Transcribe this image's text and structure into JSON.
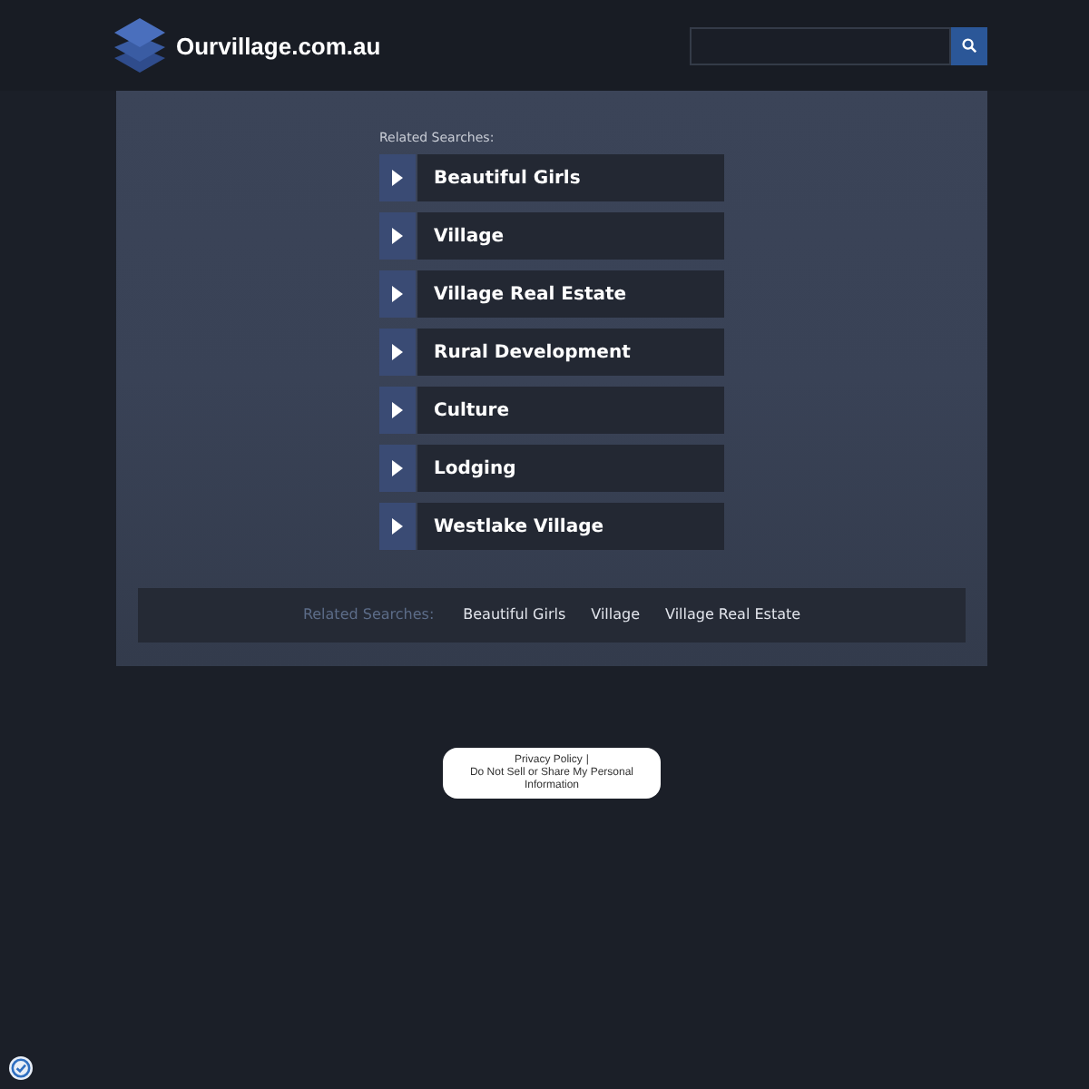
{
  "header": {
    "site_name": "Ourvillage.com.au"
  },
  "related_searches": {
    "heading": "Related Searches:",
    "items": [
      "Beautiful Girls",
      "Village",
      "Village Real Estate",
      "Rural Development",
      "Culture",
      "Lodging",
      "Westlake Village"
    ]
  },
  "footer_bar": {
    "heading": "Related Searches:",
    "links": [
      "Beautiful Girls",
      "Village",
      "Village Real Estate"
    ]
  },
  "privacy": {
    "policy_link": "Privacy Policy",
    "separator": "|",
    "do_not_sell_link": "Do Not Sell or Share My Personal Information"
  }
}
